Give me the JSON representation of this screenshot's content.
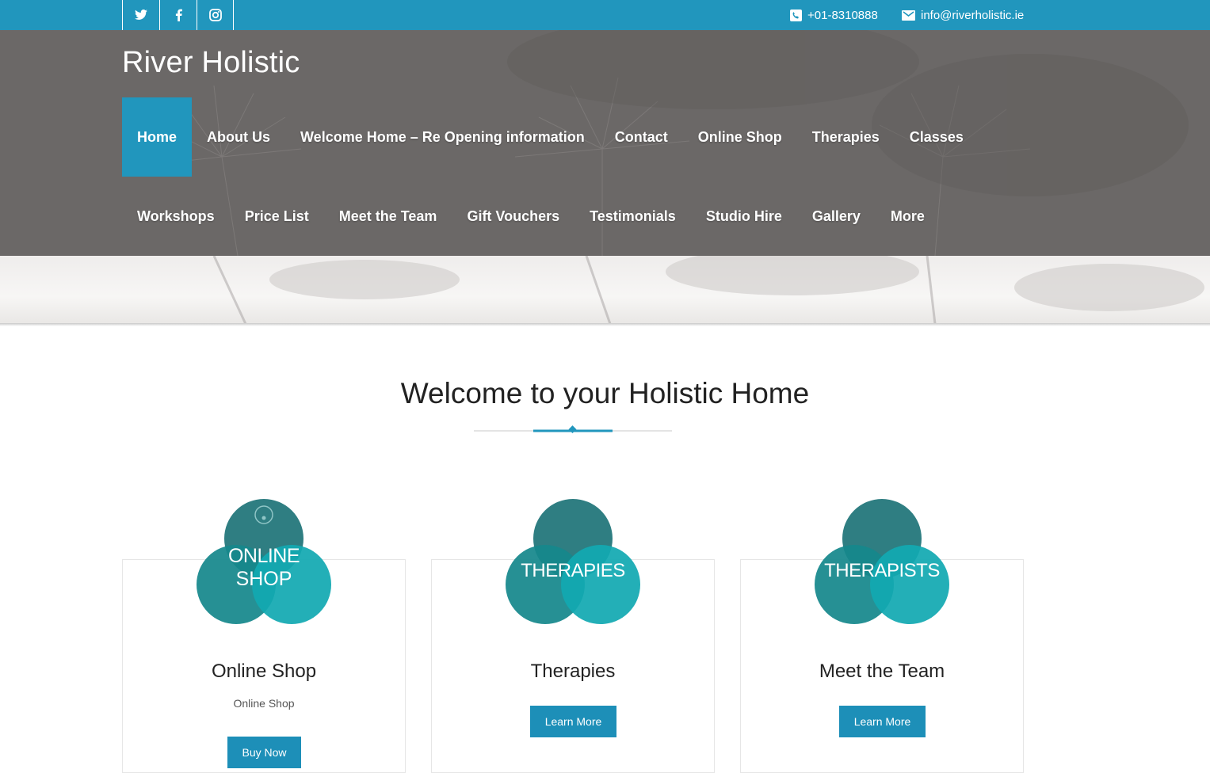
{
  "topbar": {
    "social": [
      {
        "icon": "twitter-icon",
        "glyph": "🐦"
      },
      {
        "icon": "facebook-icon",
        "glyph": "f"
      },
      {
        "icon": "instagram-icon",
        "glyph": "◎"
      }
    ],
    "phone": "+01-8310888",
    "email": "info@riverholistic.ie"
  },
  "header": {
    "brand": "River Holistic"
  },
  "nav": {
    "row1": [
      {
        "label": "Home",
        "active": true
      },
      {
        "label": "About Us"
      },
      {
        "label": "Welcome Home – Re Opening information"
      },
      {
        "label": "Contact"
      },
      {
        "label": "Online Shop"
      },
      {
        "label": "Therapies"
      },
      {
        "label": "Classes"
      }
    ],
    "row2": [
      {
        "label": "Workshops"
      },
      {
        "label": "Price List"
      },
      {
        "label": "Meet the Team"
      },
      {
        "label": "Gift Vouchers"
      },
      {
        "label": "Testimonials"
      },
      {
        "label": "Studio Hire"
      },
      {
        "label": "Gallery"
      },
      {
        "label": "More"
      }
    ]
  },
  "main": {
    "heading": "Welcome to your Holistic Home",
    "cards": [
      {
        "logo_line1": "ONLINE",
        "logo_line2": "SHOP",
        "title": "Online Shop",
        "subtitle": "Online Shop",
        "button": "Buy Now"
      },
      {
        "logo_line1": "THERAPIES",
        "logo_line2": "",
        "title": "Therapies",
        "subtitle": "",
        "button": "Learn More"
      },
      {
        "logo_line1": "THERAPISTS",
        "logo_line2": "",
        "title": "Meet the Team",
        "subtitle": "",
        "button": "Learn More"
      }
    ]
  },
  "colors": {
    "accent": "#2196bd",
    "button": "#1d8fb8",
    "circle_dark": "#1f7478",
    "circle_mid": "#16888c",
    "circle_light": "#12a9b2"
  }
}
